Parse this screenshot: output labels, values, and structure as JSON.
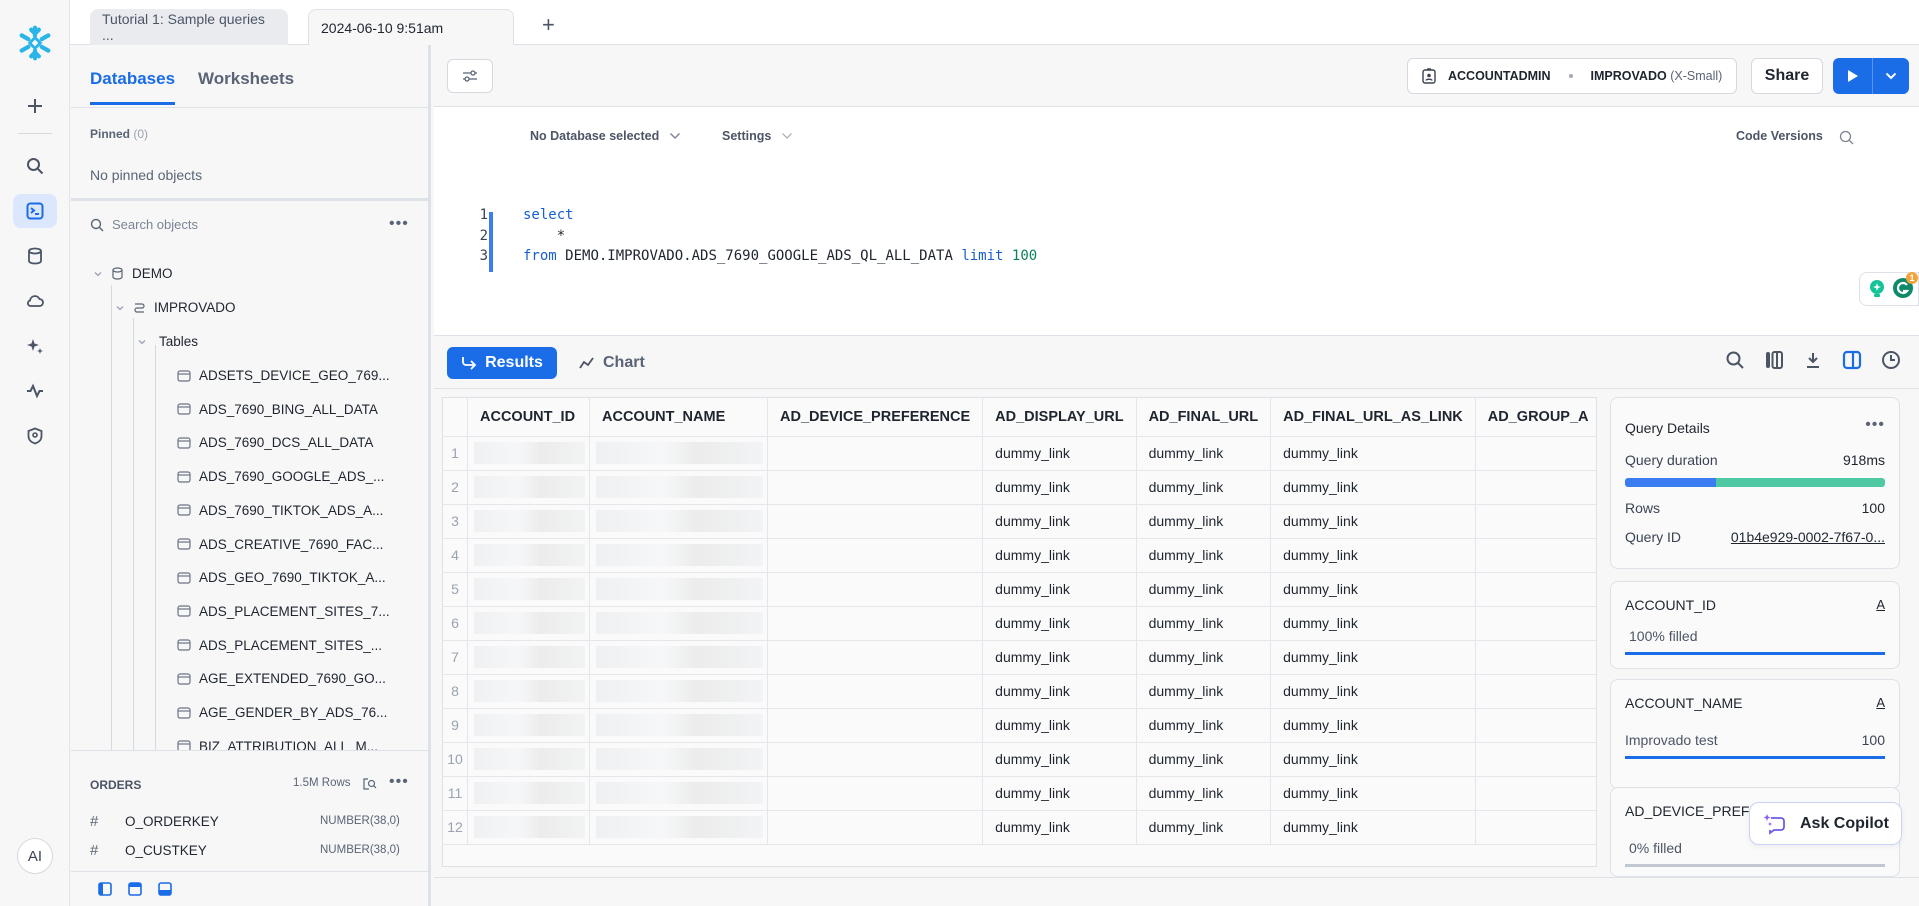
{
  "app": {
    "accent": "#1a6ce7",
    "brand": "#29b5e8"
  },
  "rail": {
    "items": [
      {
        "icon": "plus-icon",
        "label": "Create"
      },
      {
        "icon": "search-icon",
        "label": "Search"
      },
      {
        "icon": "terminal-icon",
        "label": "Projects",
        "active": true
      },
      {
        "icon": "database-icon",
        "label": "Data"
      },
      {
        "icon": "cloud-icon",
        "label": "Data Products"
      },
      {
        "icon": "sparkle-icon",
        "label": "AI & ML"
      },
      {
        "icon": "activity-icon",
        "label": "Monitoring"
      },
      {
        "icon": "shield-user-icon",
        "label": "Admin"
      }
    ],
    "avatar": "AI"
  },
  "tabs": [
    {
      "label": "Tutorial 1: Sample queries ...",
      "active": false
    },
    {
      "label": "2024-06-10 9:51am",
      "active": true
    }
  ],
  "add_tab": "+",
  "left": {
    "tabs": [
      "Databases",
      "Worksheets"
    ],
    "pinned_label": "Pinned",
    "pinned_count": "(0)",
    "no_pinned": "No pinned objects",
    "search_placeholder": "Search objects",
    "tree": {
      "db": "DEMO",
      "schema": "IMPROVADO",
      "group": "Tables",
      "tables": [
        "ADSETS_DEVICE_GEO_769...",
        "ADS_7690_BING_ALL_DATA",
        "ADS_7690_DCS_ALL_DATA",
        "ADS_7690_GOOGLE_ADS_...",
        "ADS_7690_TIKTOK_ADS_A...",
        "ADS_CREATIVE_7690_FAC...",
        "ADS_GEO_7690_TIKTOK_A...",
        "ADS_PLACEMENT_SITES_7...",
        "ADS_PLACEMENT_SITES_...",
        "AGE_EXTENDED_7690_GO...",
        "AGE_GENDER_BY_ADS_76...",
        "BIZ_ATTRIBUTION_ALL_M..."
      ]
    },
    "preview": {
      "title": "ORDERS",
      "rows": "1.5M Rows",
      "columns": [
        {
          "name": "O_ORDERKEY",
          "type": "NUMBER(38,0)"
        },
        {
          "name": "O_CUSTKEY",
          "type": "NUMBER(38,0)"
        }
      ]
    }
  },
  "toolbar": {
    "role": "ACCOUNTADMIN",
    "warehouse": "IMPROVADO",
    "warehouse_size": "(X-Small)",
    "share": "Share"
  },
  "editor": {
    "database": "No Database selected",
    "settings": "Settings",
    "code_versions": "Code Versions",
    "lines": [
      {
        "n": "1",
        "tokens": [
          {
            "t": "select",
            "c": "kw"
          }
        ]
      },
      {
        "n": "2",
        "tokens": [
          {
            "t": "    *",
            "c": "plain"
          }
        ]
      },
      {
        "n": "3",
        "tokens": [
          {
            "t": "from ",
            "c": "kw"
          },
          {
            "t": "DEMO.IMPROVADO.ADS_7690_GOOGLE_ADS_QL_ALL_DATA ",
            "c": "plain"
          },
          {
            "t": "limit ",
            "c": "kw"
          },
          {
            "t": "100",
            "c": "num"
          }
        ]
      }
    ],
    "grammarly_badge": "1"
  },
  "results": {
    "results_label": "Results",
    "chart_label": "Chart",
    "columns": [
      "ACCOUNT_ID",
      "ACCOUNT_NAME",
      "AD_DEVICE_PREFERENCE",
      "AD_DISPLAY_URL",
      "AD_FINAL_URL",
      "AD_FINAL_URL_AS_LINK",
      "AD_GROUP_A"
    ],
    "rows": [
      [
        "1",
        "",
        "",
        "",
        "dummy_link",
        "dummy_link",
        "dummy_link",
        ""
      ],
      [
        "2",
        "",
        "",
        "",
        "dummy_link",
        "dummy_link",
        "dummy_link",
        ""
      ],
      [
        "3",
        "",
        "",
        "",
        "dummy_link",
        "dummy_link",
        "dummy_link",
        ""
      ],
      [
        "4",
        "",
        "",
        "",
        "dummy_link",
        "dummy_link",
        "dummy_link",
        ""
      ],
      [
        "5",
        "",
        "",
        "",
        "dummy_link",
        "dummy_link",
        "dummy_link",
        ""
      ],
      [
        "6",
        "",
        "",
        "",
        "dummy_link",
        "dummy_link",
        "dummy_link",
        ""
      ],
      [
        "7",
        "",
        "",
        "",
        "dummy_link",
        "dummy_link",
        "dummy_link",
        ""
      ],
      [
        "8",
        "",
        "",
        "",
        "dummy_link",
        "dummy_link",
        "dummy_link",
        ""
      ],
      [
        "9",
        "",
        "",
        "",
        "dummy_link",
        "dummy_link",
        "dummy_link",
        ""
      ],
      [
        "10",
        "",
        "",
        "",
        "dummy_link",
        "dummy_link",
        "dummy_link",
        ""
      ],
      [
        "11",
        "",
        "",
        "",
        "dummy_link",
        "dummy_link",
        "dummy_link",
        ""
      ],
      [
        "12",
        "",
        "",
        "",
        "dummy_link",
        "dummy_link",
        "dummy_link",
        ""
      ]
    ]
  },
  "details": {
    "title": "Query Details",
    "duration_label": "Query duration",
    "duration": "918ms",
    "duration_split": [
      0.35,
      0.65
    ],
    "rows_label": "Rows",
    "rows": "100",
    "query_id_label": "Query ID",
    "query_id": "01b4e929-0002-7f67-0...",
    "columns": [
      {
        "name": "ACCOUNT_ID",
        "type_glyph": "A",
        "stat": "100% filled",
        "value": "",
        "fill": 1.0
      },
      {
        "name": "ACCOUNT_NAME",
        "type_glyph": "A",
        "stat": "Improvado test",
        "value": "100",
        "fill": 1.0
      },
      {
        "name": "AD_DEVICE_PREFERENCE",
        "type_glyph": "A",
        "stat": "0% filled",
        "value": "",
        "fill": 0.0
      }
    ]
  },
  "copilot": "Ask Copilot"
}
